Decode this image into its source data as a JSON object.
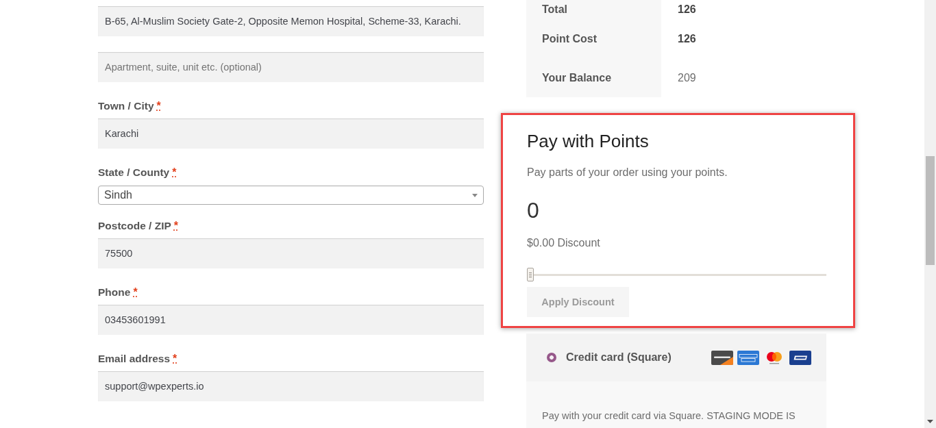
{
  "billing_fields": [
    {
      "kind": "text",
      "value": "B-65, Al-Muslim Society Gate-2, Opposite Memon Hospital, Scheme-33, Karachi."
    },
    {
      "kind": "text",
      "placeholder": "Apartment, suite, unit etc. (optional)"
    },
    {
      "kind": "text",
      "label": "Town / City",
      "required_mark": "*",
      "value": "Karachi"
    },
    {
      "kind": "select",
      "label": "State / County",
      "required_mark": "*",
      "value": "Sindh"
    },
    {
      "kind": "text",
      "label": "Postcode / ZIP",
      "required_mark": "*",
      "value": "75500"
    },
    {
      "kind": "text",
      "label": "Phone",
      "required_mark": "*",
      "value": "03453601991"
    },
    {
      "kind": "text",
      "label": "Email address",
      "required_mark": "*",
      "value": "support@wpexperts.io"
    }
  ],
  "points_summary": [
    {
      "label": "Total",
      "value": "126",
      "emphasized": true
    },
    {
      "label": "Point Cost",
      "value": "126",
      "emphasized": true
    },
    {
      "label": "Your Balance",
      "value": "209",
      "emphasized": false
    }
  ],
  "pay_with_points": {
    "title": "Pay with Points",
    "description": "Pay parts of your order using your points.",
    "points": "0",
    "discount": "$0.00 Discount",
    "slider": {
      "level": 0
    },
    "button": {
      "label": "Apply Discount",
      "disabled": true
    }
  },
  "payment_methods": [
    {
      "label": "Credit card (Square)",
      "selected": true,
      "cards": [
        {
          "kind": "discover"
        },
        {
          "kind": "amex"
        },
        {
          "kind": "mastercard"
        },
        {
          "kind": "visa"
        }
      ],
      "description": "Pay with your credit card via Square. STAGING MODE IS"
    }
  ]
}
